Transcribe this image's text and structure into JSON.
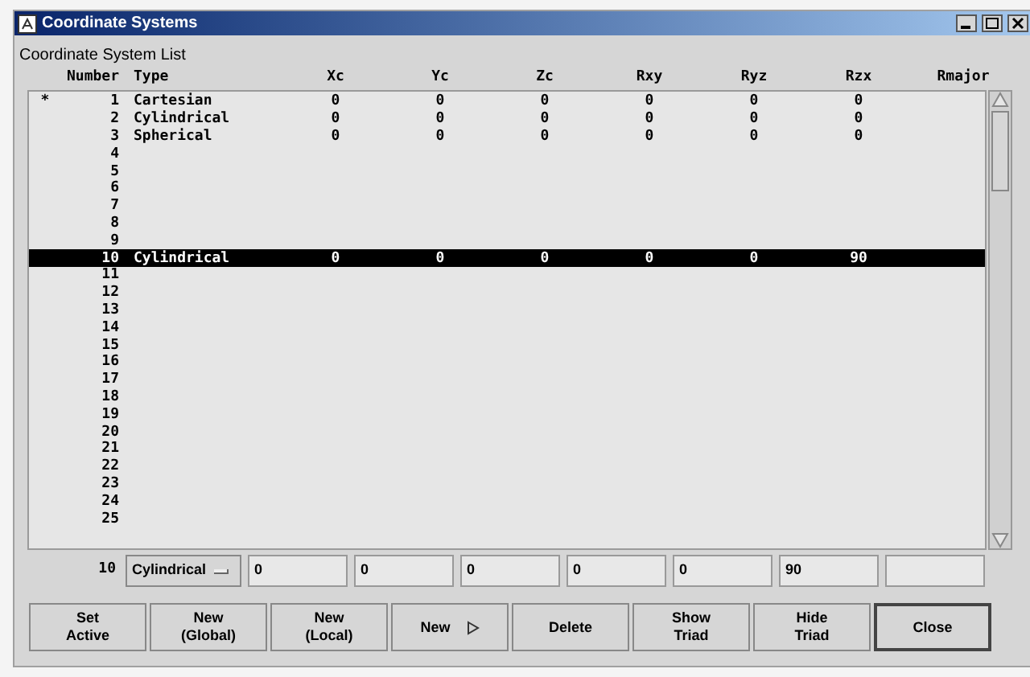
{
  "window": {
    "title": "Coordinate Systems"
  },
  "list_title": "Coordinate System List",
  "columns": [
    "Number",
    "Type",
    "Xc",
    "Yc",
    "Zc",
    "Rxy",
    "Ryz",
    "Rzx",
    "Rmajor"
  ],
  "rows": [
    {
      "marker": "*",
      "number": "1",
      "type": "Cartesian",
      "values": [
        "0",
        "0",
        "0",
        "0",
        "0",
        "0"
      ],
      "selected": false
    },
    {
      "number": "2",
      "type": "Cylindrical",
      "values": [
        "0",
        "0",
        "0",
        "0",
        "0",
        "0"
      ],
      "selected": false
    },
    {
      "number": "3",
      "type": "Spherical",
      "values": [
        "0",
        "0",
        "0",
        "0",
        "0",
        "0"
      ],
      "selected": false
    },
    {
      "number": "4",
      "selected": false
    },
    {
      "number": "5",
      "selected": false
    },
    {
      "number": "6",
      "selected": false
    },
    {
      "number": "7",
      "selected": false
    },
    {
      "number": "8",
      "selected": false
    },
    {
      "number": "9",
      "selected": false
    },
    {
      "number": "10",
      "type": "Cylindrical",
      "values": [
        "0",
        "0",
        "0",
        "0",
        "0",
        "90"
      ],
      "selected": true
    },
    {
      "number": "11",
      "selected": false
    },
    {
      "number": "12",
      "selected": false
    },
    {
      "number": "13",
      "selected": false
    },
    {
      "number": "14",
      "selected": false
    },
    {
      "number": "15",
      "selected": false
    },
    {
      "number": "16",
      "selected": false
    },
    {
      "number": "17",
      "selected": false
    },
    {
      "number": "18",
      "selected": false
    },
    {
      "number": "19",
      "selected": false
    },
    {
      "number": "20",
      "selected": false
    },
    {
      "number": "21",
      "selected": false
    },
    {
      "number": "22",
      "selected": false
    },
    {
      "number": "23",
      "selected": false
    },
    {
      "number": "24",
      "selected": false
    },
    {
      "number": "25",
      "selected": false
    }
  ],
  "editor": {
    "number": "10",
    "type": "Cylindrical",
    "fields": [
      "0",
      "0",
      "0",
      "0",
      "0",
      "90"
    ]
  },
  "buttons": [
    {
      "label": "Set\nActive",
      "kind": "plain"
    },
    {
      "label": "New\n(Global)",
      "kind": "plain"
    },
    {
      "label": "New\n(Local)",
      "kind": "plain"
    },
    {
      "label": "New",
      "kind": "cascade"
    },
    {
      "label": "Delete",
      "kind": "plain"
    },
    {
      "label": "Show\nTriad",
      "kind": "plain"
    },
    {
      "label": "Hide\nTriad",
      "kind": "plain"
    },
    {
      "label": "Close",
      "kind": "default"
    }
  ]
}
